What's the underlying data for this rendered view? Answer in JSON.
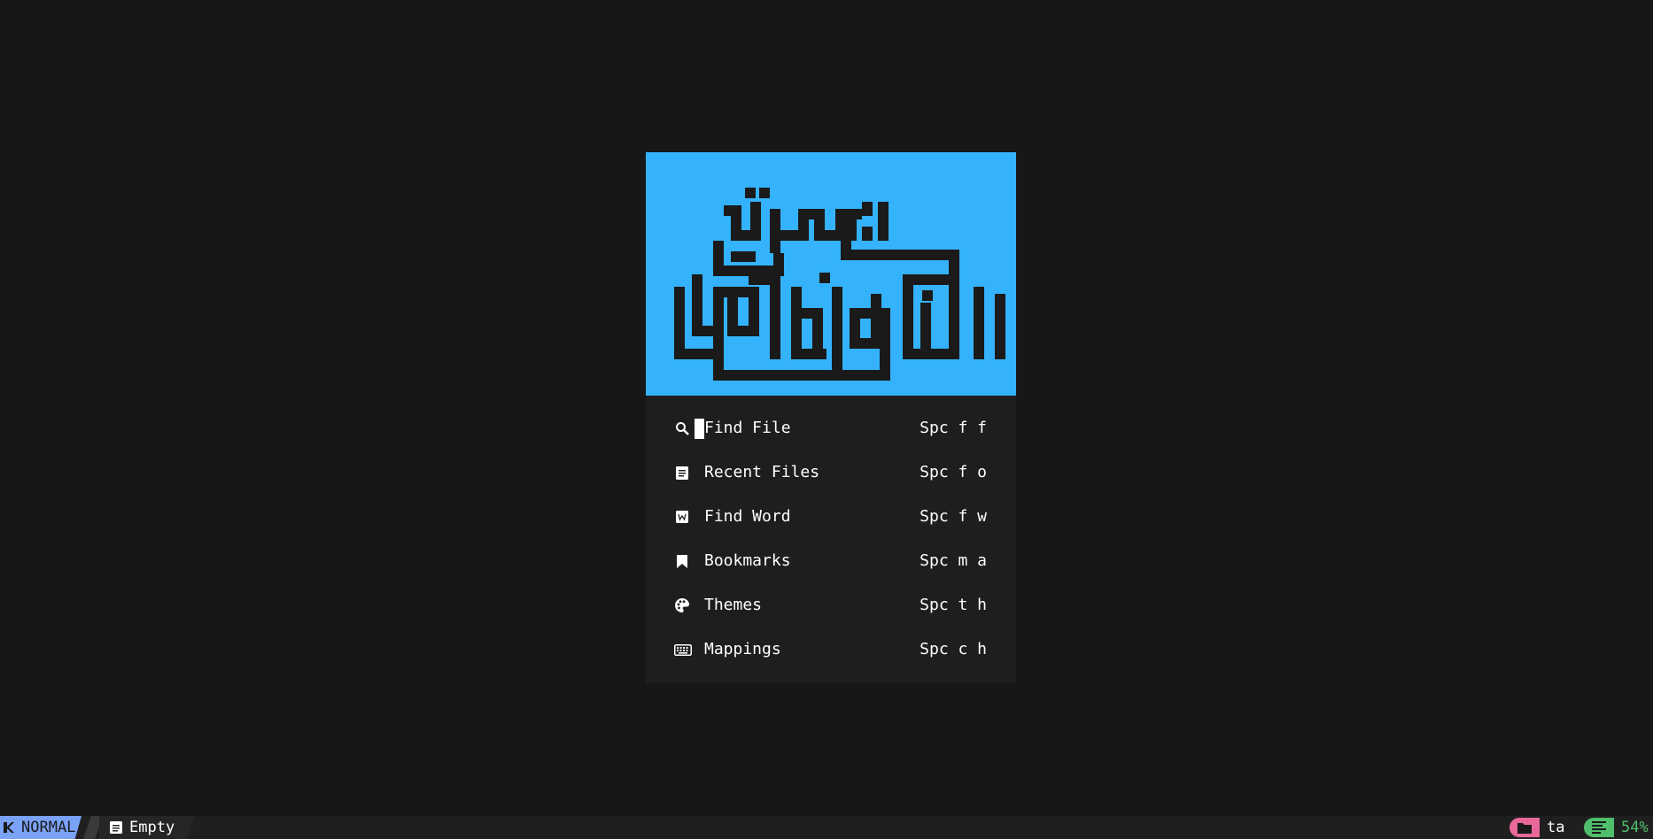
{
  "header": {
    "logo_text": "العلم قبل القول والعمل"
  },
  "menu": [
    {
      "icon": "search-icon",
      "label": "Find File",
      "shortcut": "Spc f f"
    },
    {
      "icon": "document-icon",
      "label": "Recent Files",
      "shortcut": "Spc f o"
    },
    {
      "icon": "word-icon",
      "label": "Find Word",
      "shortcut": "Spc f w"
    },
    {
      "icon": "bookmark-icon",
      "label": "Bookmarks",
      "shortcut": "Spc m a"
    },
    {
      "icon": "palette-icon",
      "label": "Themes",
      "shortcut": "Spc t h"
    },
    {
      "icon": "keyboard-icon",
      "label": "Mappings",
      "shortcut": "Spc c h"
    }
  ],
  "statusline": {
    "mode": "NORMAL",
    "file": "Empty",
    "cwd": "ta",
    "percent": "54%"
  },
  "colors": {
    "background": "#171717",
    "header_bg": "#34b2fb",
    "mode_bg": "#7aa2f7",
    "folder_accent": "#e8689a",
    "progress_accent": "#4fbf6b"
  }
}
